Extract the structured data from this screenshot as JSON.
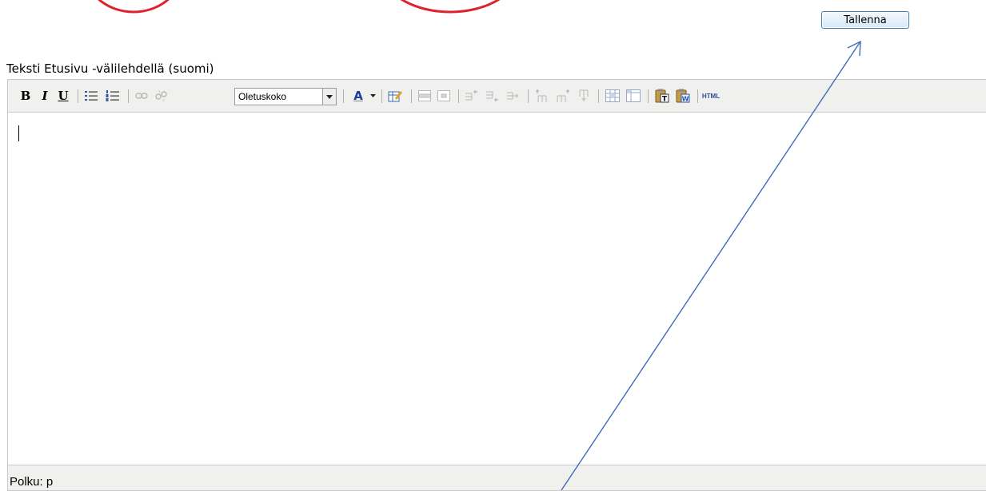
{
  "toolbar_header": {
    "save_label": "Tallenna"
  },
  "editor": {
    "label": "Teksti Etusivu -välilehdellä (suomi)",
    "toolbar": {
      "bold": "B",
      "italic": "I",
      "underline": "U",
      "font_size_selected": "Oletuskoko",
      "font_color_letter": "A",
      "html_button": "HTML"
    },
    "content": "",
    "status": {
      "path_label": "Polku: p"
    }
  },
  "icons": [
    "bold-icon",
    "italic-icon",
    "underline-icon",
    "bullet-list-icon",
    "numbered-list-icon",
    "link-icon",
    "unlink-icon",
    "font-color-icon",
    "edit-table-icon",
    "row-props-icon",
    "cell-props-icon",
    "insert-row-before-icon",
    "insert-row-after-icon",
    "delete-row-icon",
    "insert-col-before-icon",
    "insert-col-after-icon",
    "delete-col-icon",
    "merge-cells-icon",
    "split-cells-icon",
    "paste-text-icon",
    "paste-word-icon"
  ],
  "colors": {
    "annotation_red": "#e0202a",
    "annotation_arrow": "#3d6cb8",
    "button_border": "#3c7fb1",
    "toolbar_bg": "#f0f0ee",
    "editor_border": "#c8c8c8"
  }
}
